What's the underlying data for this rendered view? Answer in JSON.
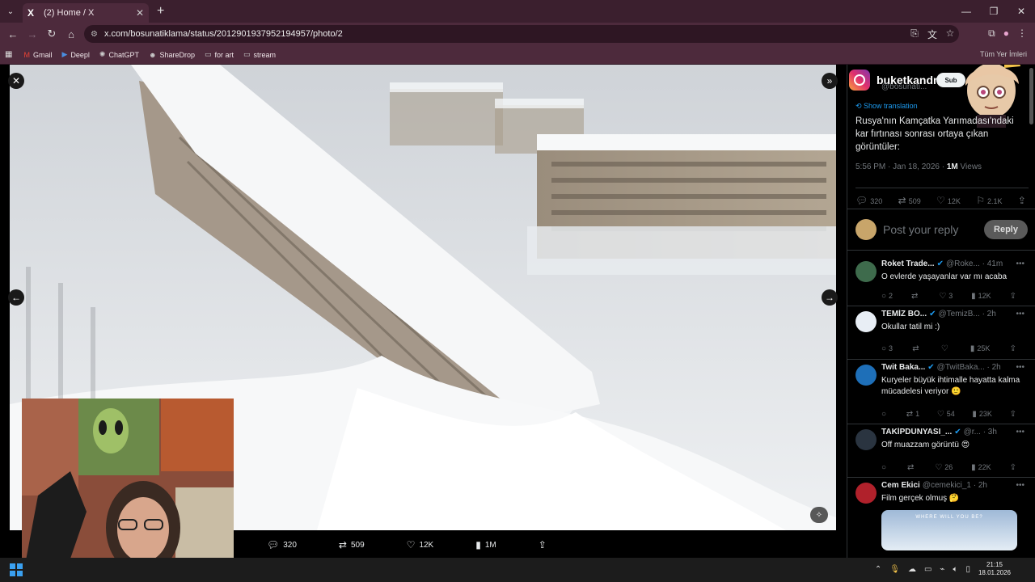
{
  "browser": {
    "tab_title": "(2) Home / X",
    "tab_logo": "X",
    "url": "x.com/bosunatiklama/status/2012901937952194957/photo/2",
    "bookmarks": [
      {
        "label": "Gmail",
        "icon": "gmail-icon"
      },
      {
        "label": "Deepl",
        "icon": "deepl-icon"
      },
      {
        "label": "ChatGPT",
        "icon": "chatgpt-icon"
      },
      {
        "label": "ShareDrop",
        "icon": "sharedrop-icon"
      },
      {
        "label": "for art",
        "icon": "folder-icon"
      },
      {
        "label": "stream",
        "icon": "folder-icon"
      }
    ],
    "bookmarks_right": "Tüm Yer İmleri"
  },
  "viewer": {
    "stats": {
      "replies": "320",
      "reposts": "509",
      "likes": "12K",
      "views": "1M"
    }
  },
  "sidebar": {
    "overlay_handle": "buketkandm",
    "author_handle": "@bosunati...",
    "subscribe_label": "Sub",
    "show_translation": "Show translation",
    "tweet_text": "Rusya'nın Kamçatka Yarımadası'ndaki kar fırtınası sonrası ortaya çıkan görüntüler:",
    "time": "5:56 PM · Jan 18, 2026 ·",
    "views_count": "1M",
    "views_label": "Views",
    "stats": {
      "replies": "320",
      "reposts": "509",
      "likes": "12K",
      "bookmarks": "2.1K"
    },
    "reply_placeholder": "Post your reply",
    "reply_button": "Reply",
    "replies": [
      {
        "name": "Roket Trade...",
        "handle": "@Roke...",
        "time": "· 41m",
        "text": "O evlerde yaşayanlar var mı acaba",
        "replies": "2",
        "reposts": "",
        "likes": "3",
        "views": "12K",
        "avatar_color": "#3e6b4c"
      },
      {
        "name": "TEMİZ BO...",
        "handle": "@TemizB...",
        "time": "· 2h",
        "text": "Okullar tatil mi :)",
        "replies": "3",
        "reposts": "",
        "likes": "",
        "views": "25K",
        "avatar_color": "#e8eef5"
      },
      {
        "name": "Twit Baka...",
        "handle": "@TwitBaka...",
        "time": "· 2h",
        "text": "Kuryeler büyük ihtimalle hayatta kalma mücadelesi veriyor 🙂",
        "replies": "",
        "reposts": "1",
        "likes": "54",
        "views": "23K",
        "avatar_color": "#1e6fb8"
      },
      {
        "name": "TAKİPDÜNYASI_...",
        "handle": "@r...",
        "time": "· 3h",
        "text": "Off muazzam görüntü 😍",
        "replies": "",
        "reposts": "",
        "likes": "26",
        "views": "22K",
        "avatar_color": "#2a3440"
      },
      {
        "name": "Cem Ekici",
        "handle": "@cemekici_1",
        "time": "· 2h",
        "text": "Film gerçek olmuş 🤔",
        "replies": "",
        "reposts": "",
        "likes": "",
        "views": "",
        "avatar_color": "#b0212b"
      }
    ],
    "reply_image_caption": "WHERE WILL YOU BE?"
  },
  "taskbar": {
    "time": "21:15",
    "date": "18.01.2026"
  }
}
